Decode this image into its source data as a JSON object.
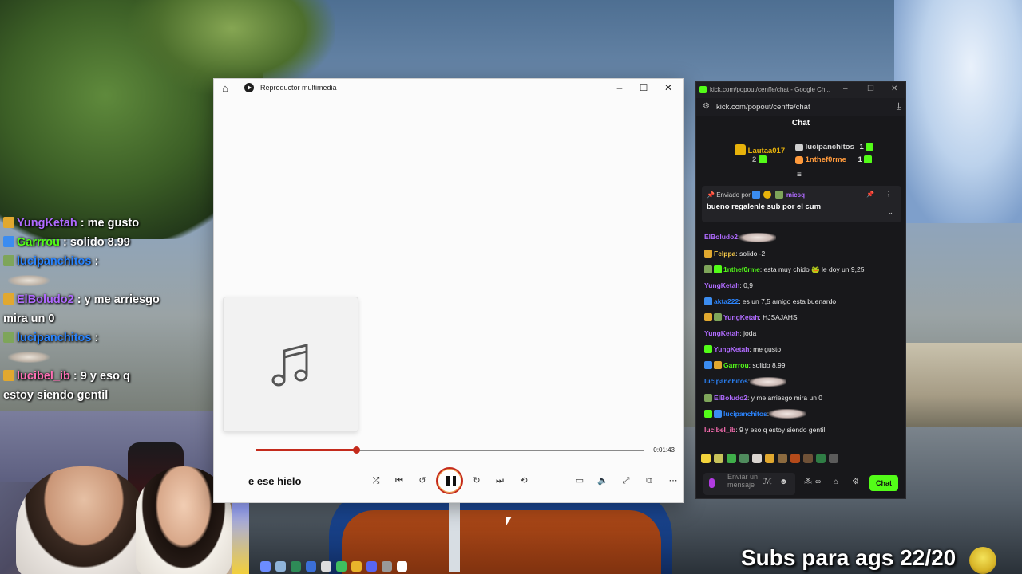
{
  "overlay_chat": [
    {
      "user": "YungKetah",
      "text": " : me gusto",
      "color": "#b06bff"
    },
    {
      "user": "Garrrou",
      "text": " : solido 8.99",
      "color": "#53fc18"
    },
    {
      "user": "lucipanchitos",
      "text": " :",
      "color": "#2b85ff"
    },
    {
      "user": "ElBoludo2",
      "text": " : y me arriesgo",
      "color": "#b06bff"
    },
    {
      "user": "",
      "text": "mira un 0",
      "color": "#ffffff"
    },
    {
      "user": "lucipanchitos",
      "text": " :",
      "color": "#2b85ff"
    },
    {
      "user": "lucibel_ib",
      "text": " : 9 y eso q",
      "color": "#ff6fb5"
    },
    {
      "user": "",
      "text": "estoy siendo gentil",
      "color": "#ffffff"
    }
  ],
  "subs_banner": "Subs para ags 22/20",
  "player": {
    "title": "Reproductor multimedia",
    "time": "0:01:43",
    "progress_fraction": 0.26,
    "song_title_fragment": "e ese hielo"
  },
  "chat_window": {
    "window_title": "kick.com/popout/cenffe/chat - Google Ch...",
    "url": "kick.com/popout/cenffe/chat",
    "header": "Chat",
    "leaderboard": [
      {
        "name": "Lautaa017",
        "count": "2",
        "color": "#e7b20b"
      },
      {
        "name": "lucipanchitos",
        "count": "1",
        "color": "#d6d6d6"
      },
      {
        "name": "1nthef0rme",
        "count": "1",
        "color": "#ff9a3c"
      }
    ],
    "pinned": {
      "by_label": "Enviado por",
      "by_user": "micsq",
      "message": "bueno regalenle sub por el cum"
    },
    "messages": [
      {
        "user": "ElBoludo2",
        "text": ":",
        "color": "#b06bff"
      },
      {
        "user": "Felppa",
        "text": ": solido -2",
        "color": "#f7c948"
      },
      {
        "user": "1nthef0rme",
        "text": ": esta muy chido 🐸 le doy un 9,25",
        "color": "#53fc18"
      },
      {
        "user": "YungKetah",
        "text": ": 0,9",
        "color": "#b06bff"
      },
      {
        "user": "akta222",
        "text": ": es un 7,5 amigo esta buenardo",
        "color": "#2b85ff"
      },
      {
        "user": "YungKetah",
        "text": ": HJSAJAHS",
        "color": "#b06bff"
      },
      {
        "user": "YungKetah",
        "text": ": joda",
        "color": "#b06bff"
      },
      {
        "user": "YungKetah",
        "text": ": me gusto",
        "color": "#b06bff"
      },
      {
        "user": "Garrrou",
        "text": ": solido 8.99",
        "color": "#53fc18"
      },
      {
        "user": "lucipanchitos",
        "text": ":",
        "color": "#2b85ff"
      },
      {
        "user": "ElBoludo2",
        "text": ": y me arriesgo mira un 0",
        "color": "#b06bff"
      },
      {
        "user": "lucipanchitos",
        "text": ":",
        "color": "#2b85ff"
      },
      {
        "user": "lucibel_ib",
        "text": ": 9 y eso q estoy siendo gentil",
        "color": "#ff6fb5"
      }
    ],
    "input_placeholder": "Enviar un mensaje",
    "send_label": "Chat",
    "accent": "#53fc18"
  }
}
